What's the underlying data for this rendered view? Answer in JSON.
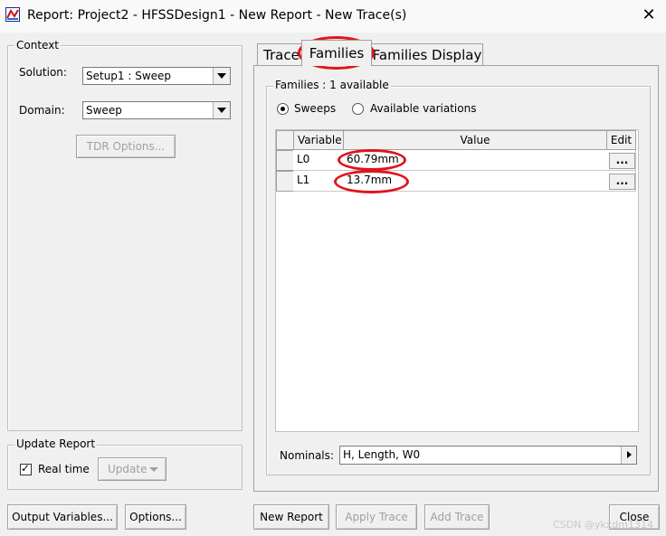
{
  "window": {
    "title": "Report: Project2 - HFSSDesign1 - New Report - New Trace(s)",
    "close_glyph": "✕"
  },
  "context": {
    "legend": "Context",
    "solution_label": "Solution:",
    "solution_value": "Setup1 : Sweep",
    "domain_label": "Domain:",
    "domain_value": "Sweep",
    "tdr_button": "TDR Options..."
  },
  "update_report": {
    "legend": "Update Report",
    "realtime_label": "Real time",
    "realtime_checked": true,
    "update_button": "Update"
  },
  "tabs": [
    {
      "label": "Trace",
      "active": false
    },
    {
      "label": "Families",
      "active": true
    },
    {
      "label": "Families Display",
      "active": false
    }
  ],
  "families": {
    "legend": "Families : 1 available",
    "radio_sweeps": "Sweeps",
    "radio_variations": "Available variations",
    "columns": [
      "Variable",
      "Value",
      "Edit"
    ],
    "rows": [
      {
        "variable": "L0",
        "value": "60.79mm",
        "edit": "..."
      },
      {
        "variable": "L1",
        "value": "13.7mm",
        "edit": "..."
      }
    ],
    "nominals_label": "Nominals:",
    "nominals_value": "H, Length, W0"
  },
  "bottom_buttons": {
    "output_variables": "Output Variables...",
    "options": "Options...",
    "new_report": "New Report",
    "apply_trace": "Apply Trace",
    "add_trace": "Add Trace",
    "close": "Close"
  },
  "watermark": "CSDN @ykxdm1314",
  "colors": {
    "annotation_oval": "#e0141e",
    "window_bg": "#f0f0f0"
  }
}
